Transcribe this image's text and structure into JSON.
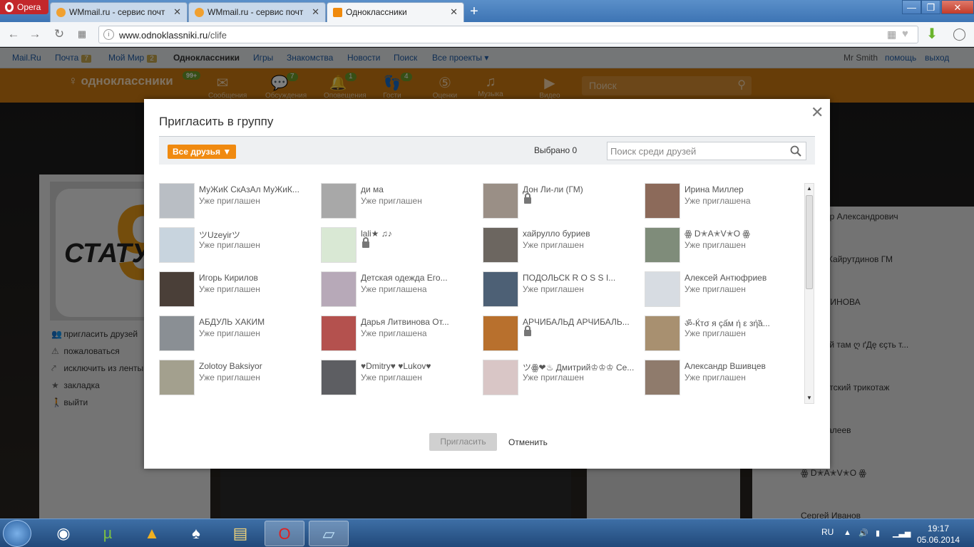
{
  "browser": {
    "app_name": "Opera",
    "tabs": [
      {
        "label": "WMmail.ru - сервис почт"
      },
      {
        "label": "WMmail.ru - сервис почт"
      },
      {
        "label": "Одноклассники"
      }
    ],
    "url_domain": "www.odnoklassniki.ru",
    "url_path": "/clife"
  },
  "mailbar": {
    "links": [
      "Mail.Ru",
      "Почта",
      "Мой Мир",
      "Одноклассники",
      "Игры",
      "Знакомства",
      "Новости",
      "Поиск",
      "Все проекты ▾"
    ],
    "mail_count": "7",
    "world_count": "2",
    "user": "Mr Smith",
    "help": "помощь",
    "logout": "выход"
  },
  "okheader": {
    "logo": "одноклассники",
    "logo_badge": "99+",
    "icons": [
      {
        "name": "Сообщения",
        "icon": "envelope-icon"
      },
      {
        "name": "Обсуждения",
        "icon": "chat-icon",
        "badge": "7"
      },
      {
        "name": "Оповещения",
        "icon": "bell-icon",
        "badge": "1"
      },
      {
        "name": "Гости",
        "icon": "footprints-icon",
        "badge": "4"
      },
      {
        "name": "Оценки",
        "icon": "rating-icon"
      },
      {
        "name": "Музыка",
        "icon": "music-icon"
      },
      {
        "name": "Видео",
        "icon": "video-icon"
      }
    ],
    "search_placeholder": "Поиск"
  },
  "left_menu": {
    "status_text": "СТАТУС",
    "status_number": "9",
    "items": [
      "пригласить друзей",
      "пожаловаться",
      "исключить из ленты",
      "закладка",
      "выйти"
    ]
  },
  "right_column": {
    "names": [
      "ндр Александрович",
      "й Хайрутдинов ГМ",
      "АТИНОВА",
      "рай там ღ ґДę єçть т...",
      "детский трикотаж",
      "Малеев",
      "ꙮ D✭A✭V✭O ꙮ",
      "Сергей Иванов"
    ]
  },
  "dialog": {
    "title": "Пригласить в группу",
    "filter_label": "Все друзья ▼",
    "selected_label": "Выбрано 0",
    "search_placeholder": "Поиск среди друзей",
    "invite_label": "Пригласить",
    "cancel_label": "Отменить",
    "friends": [
      {
        "name": "МуЖиК СкАзАл МуЖиК...",
        "status": "Уже приглашен",
        "locked": false,
        "color": "#b9bec4"
      },
      {
        "name": "ди ма",
        "status": "Уже приглашен",
        "locked": false,
        "color": "#a8a8a8"
      },
      {
        "name": "Дон Ли-ли (ГМ)",
        "status": "",
        "locked": true,
        "color": "#9a8f86"
      },
      {
        "name": "Ирина Миллер",
        "status": "Уже приглашена",
        "locked": false,
        "color": "#8c6a5a"
      },
      {
        "name": "ツUzeyirツ",
        "status": "Уже приглашен",
        "locked": false,
        "color": "#c8d4de"
      },
      {
        "name": "lali★ ♫♪",
        "status": "",
        "locked": true,
        "color": "#d9e8d4"
      },
      {
        "name": "хайрулло буриев",
        "status": "Уже приглашен",
        "locked": false,
        "color": "#6c6660"
      },
      {
        "name": "ꙮ D✭A✭V✭O ꙮ",
        "status": "Уже приглашен",
        "locked": false,
        "color": "#7f8c7a"
      },
      {
        "name": "Игорь Кирилов",
        "status": "Уже приглашен",
        "locked": false,
        "color": "#4a3f38"
      },
      {
        "name": "Детская одежда Его...",
        "status": "Уже приглашена",
        "locked": false,
        "color": "#b7a9b8"
      },
      {
        "name": "ПОДОЛЬСК R O S S I...",
        "status": "Уже приглашен",
        "locked": false,
        "color": "#4d6075"
      },
      {
        "name": "Алексей Антюфриев",
        "status": "Уже приглашен",
        "locked": false,
        "color": "#d7dce2"
      },
      {
        "name": "АБДУЛЬ ХАКИМ",
        "status": "Уже приглашен",
        "locked": false,
        "color": "#8a8f94"
      },
      {
        "name": "Дарья Литвинова От...",
        "status": "Уже приглашена",
        "locked": false,
        "color": "#b4514e"
      },
      {
        "name": "АРЧИБАЛЬД АРЧИБАЛЬ...",
        "status": "",
        "locked": true,
        "color": "#b8702d"
      },
      {
        "name": "ॐ-Ќтσ я çấм ή ε зή̃á...",
        "status": "Уже приглашен",
        "locked": false,
        "color": "#a89070"
      },
      {
        "name": "Zolotoy Baksiyor",
        "status": "Уже приглашен",
        "locked": false,
        "color": "#a3a08e"
      },
      {
        "name": "♥Dmitry♥ ♥Lukov♥",
        "status": "Уже приглашен",
        "locked": false,
        "color": "#5d5e62"
      },
      {
        "name": "ツꙮ❤♨ Дмитрий♔♔♔ Се...",
        "status": "Уже приглашен",
        "locked": false,
        "color": "#d9c6c6"
      },
      {
        "name": "Александр Вшивцев",
        "status": "Уже приглашен",
        "locked": false,
        "color": "#8f7b6c"
      }
    ]
  },
  "taskbar": {
    "lang": "RU",
    "time": "19:17",
    "date": "05.06.2014"
  }
}
